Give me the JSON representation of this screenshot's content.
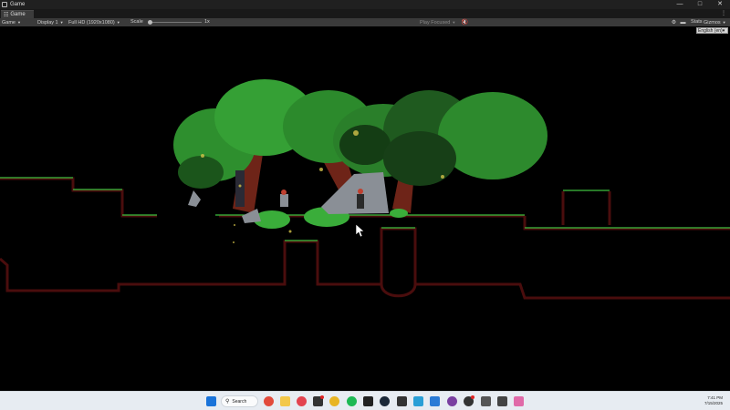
{
  "window": {
    "title": "Game",
    "controls": {
      "minimize": "—",
      "maximize": "□",
      "close": "✕"
    }
  },
  "tab": {
    "label": "Game",
    "menu": "⋮"
  },
  "toolbar": {
    "view_mode": "Game",
    "display": "Display 1",
    "resolution": "Full HD (1920x1080)",
    "scale_label": "Scale",
    "scale_value": "1x",
    "play_mode": "Play Focused",
    "stats": "Stats",
    "gizmos": "Gizmos"
  },
  "game_ui": {
    "language_select": "English (en)"
  },
  "taskbar": {
    "search_label": "Search",
    "time": "7:41 PM",
    "date": "7/15/2025"
  },
  "colors": {
    "platform_outline": "#5a1010",
    "grass": "#3fbf3f",
    "foliage": "#2f9a2f",
    "trunk": "#7a2a1a",
    "taskbar_bg": "#e7ecf2"
  }
}
